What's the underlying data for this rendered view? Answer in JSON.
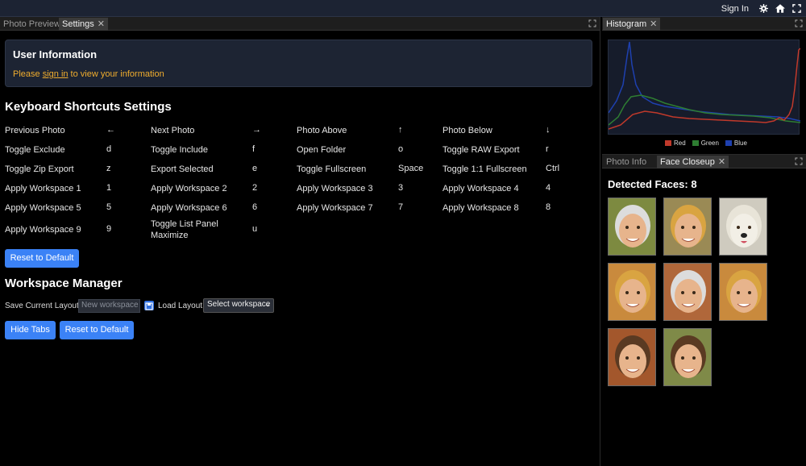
{
  "topbar": {
    "signin": "Sign In",
    "icons": [
      "gear-icon",
      "home-icon",
      "fullscreen-icon"
    ]
  },
  "left_tabs": [
    {
      "label": "Photo Preview",
      "active": false
    },
    {
      "label": "Settings",
      "active": true
    }
  ],
  "user_info": {
    "title": "User Information",
    "prefix": "Please ",
    "link": "sign in",
    "suffix": " to view your information"
  },
  "shortcuts_title": "Keyboard Shortcuts Settings",
  "shortcuts": [
    {
      "label": "Previous Photo",
      "key": "←"
    },
    {
      "label": "Next Photo",
      "key": "→"
    },
    {
      "label": "Photo Above",
      "key": "↑"
    },
    {
      "label": "Photo Below",
      "key": "↓"
    },
    {
      "label": "Toggle Exclude",
      "key": "d"
    },
    {
      "label": "Toggle Include",
      "key": "f"
    },
    {
      "label": "Open Folder",
      "key": "o"
    },
    {
      "label": "Toggle RAW Export",
      "key": "r"
    },
    {
      "label": "Toggle Zip Export",
      "key": "z"
    },
    {
      "label": "Export Selected",
      "key": "e"
    },
    {
      "label": "Toggle Fullscreen",
      "key": "Space"
    },
    {
      "label": "Toggle 1:1 Fullscreen",
      "key": "Ctrl"
    },
    {
      "label": "Apply Workspace 1",
      "key": "1"
    },
    {
      "label": "Apply Workspace 2",
      "key": "2"
    },
    {
      "label": "Apply Workspace 3",
      "key": "3"
    },
    {
      "label": "Apply Workspace 4",
      "key": "4"
    },
    {
      "label": "Apply Workspace 5",
      "key": "5"
    },
    {
      "label": "Apply Workspace 6",
      "key": "6"
    },
    {
      "label": "Apply Workspace 7",
      "key": "7"
    },
    {
      "label": "Apply Workspace 8",
      "key": "8"
    },
    {
      "label": "Apply Workspace 9",
      "key": "9"
    },
    {
      "label": "Toggle List Panel Maximize",
      "key": "u"
    }
  ],
  "reset_label": "Reset to Default",
  "workspace": {
    "title": "Workspace Manager",
    "save_label": "Save Current Layout:",
    "placeholder": "New workspace",
    "load_label": "Load Layout:",
    "select_value": "Select workspace",
    "hide_tabs": "Hide Tabs",
    "reset": "Reset to Default"
  },
  "histogram": {
    "tab": "Histogram",
    "legend": [
      {
        "name": "Red",
        "color": "#c0392b"
      },
      {
        "name": "Green",
        "color": "#2e7d32"
      },
      {
        "name": "Blue",
        "color": "#1e40af"
      }
    ]
  },
  "right_tabs": [
    {
      "label": "Photo Info",
      "active": false
    },
    {
      "label": "Face Closeup",
      "active": true
    }
  ],
  "faces": {
    "title": "Detected Faces: 8",
    "items": [
      {
        "name": "older-man-glasses",
        "bg": "#7d8a40"
      },
      {
        "name": "young-woman",
        "bg": "#9a8a55"
      },
      {
        "name": "white-dog",
        "bg": "#cfcbbf"
      },
      {
        "name": "smiling-woman",
        "bg": "#c98a3d"
      },
      {
        "name": "older-man-beard",
        "bg": "#b0673a"
      },
      {
        "name": "girl",
        "bg": "#c98a3d"
      },
      {
        "name": "bearded-man",
        "bg": "#a3572c"
      },
      {
        "name": "boy",
        "bg": "#7f8a48"
      }
    ]
  },
  "colors": {
    "accent": "#3b82f6",
    "warning": "#f0ad2e",
    "topbar": "#1c2333"
  }
}
